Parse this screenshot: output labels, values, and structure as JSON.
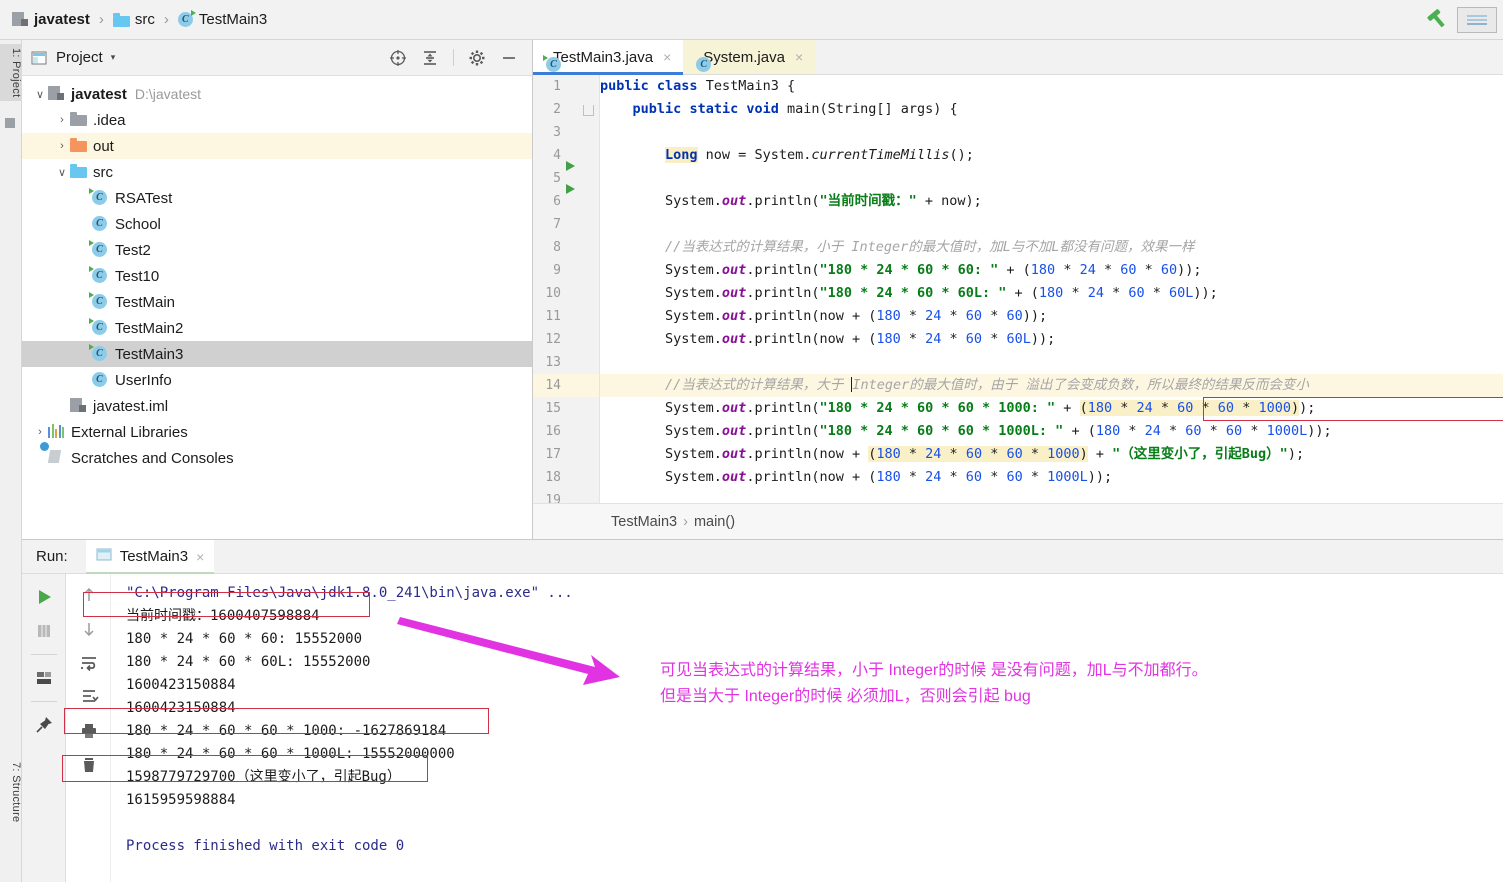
{
  "window": {
    "breadcrumb": [
      {
        "label": "javatest",
        "icon": "module-icon",
        "bold": true
      },
      {
        "label": "src",
        "icon": "folder-icon",
        "bold": false
      },
      {
        "label": "TestMain3",
        "icon": "java-class-icon",
        "bold": false
      }
    ],
    "hammer_icon": "build-hammer-icon",
    "restore_icon": "restore-window-icon"
  },
  "left_strip": {
    "project_tab": "1: Project",
    "structure_tab": "7: Structure"
  },
  "project_panel": {
    "title": "Project",
    "caret": "▾",
    "tools": [
      {
        "name": "locate-icon",
        "label": "Select Opened File"
      },
      {
        "name": "collapse-all-icon",
        "label": "Collapse All"
      },
      {
        "name": "gear-icon",
        "label": "Settings"
      },
      {
        "name": "minimize-icon",
        "label": "Hide"
      }
    ],
    "tree": [
      {
        "label": "javatest",
        "path": "D:\\javatest",
        "icon": "module-icon",
        "arrow": "∨",
        "indent": 0,
        "bold": true,
        "state": "normal"
      },
      {
        "label": ".idea",
        "path": "",
        "icon": "folder-gray-icon",
        "arrow": "›",
        "indent": 1,
        "bold": false,
        "state": "normal"
      },
      {
        "label": "out",
        "path": "",
        "icon": "folder-orange-icon",
        "arrow": "›",
        "indent": 1,
        "bold": false,
        "state": "highlight"
      },
      {
        "label": "src",
        "path": "",
        "icon": "folder-blue-icon",
        "arrow": "∨",
        "indent": 1,
        "bold": false,
        "state": "normal"
      },
      {
        "label": "RSATest",
        "path": "",
        "icon": "java-class-runnable-icon",
        "arrow": "",
        "indent": 2,
        "bold": false,
        "state": "normal"
      },
      {
        "label": "School",
        "path": "",
        "icon": "java-class-icon",
        "arrow": "",
        "indent": 2,
        "bold": false,
        "state": "normal"
      },
      {
        "label": "Test2",
        "path": "",
        "icon": "java-class-runnable-icon",
        "arrow": "",
        "indent": 2,
        "bold": false,
        "state": "normal"
      },
      {
        "label": "Test10",
        "path": "",
        "icon": "java-class-runnable-icon",
        "arrow": "",
        "indent": 2,
        "bold": false,
        "state": "normal"
      },
      {
        "label": "TestMain",
        "path": "",
        "icon": "java-class-runnable-icon",
        "arrow": "",
        "indent": 2,
        "bold": false,
        "state": "normal"
      },
      {
        "label": "TestMain2",
        "path": "",
        "icon": "java-class-runnable-icon",
        "arrow": "",
        "indent": 2,
        "bold": false,
        "state": "normal"
      },
      {
        "label": "TestMain3",
        "path": "",
        "icon": "java-class-runnable-icon",
        "arrow": "",
        "indent": 2,
        "bold": false,
        "state": "selected"
      },
      {
        "label": "UserInfo",
        "path": "",
        "icon": "java-class-icon",
        "arrow": "",
        "indent": 2,
        "bold": false,
        "state": "normal"
      },
      {
        "label": "javatest.iml",
        "path": "",
        "icon": "module-file-icon",
        "arrow": "",
        "indent": 1,
        "bold": false,
        "state": "normal"
      },
      {
        "label": "External Libraries",
        "path": "",
        "icon": "libraries-icon",
        "arrow": "›",
        "indent": 0,
        "bold": false,
        "state": "normal"
      },
      {
        "label": "Scratches and Consoles",
        "path": "",
        "icon": "scratches-icon",
        "arrow": "",
        "indent": 0,
        "bold": false,
        "state": "normal"
      }
    ]
  },
  "editor": {
    "tabs": [
      {
        "label": "TestMain3.java",
        "icon": "java-class-runnable-icon",
        "active": true,
        "close": "×"
      },
      {
        "label": "System.java",
        "icon": "java-class-readonly-icon",
        "active": false,
        "close": "×"
      }
    ],
    "breadcrumb": {
      "class": "TestMain3",
      "sep": "›",
      "method": "main()"
    },
    "line_numbers": [
      "1",
      "2",
      "3",
      "4",
      "5",
      "6",
      "7",
      "8",
      "9",
      "10",
      "11",
      "12",
      "13",
      "14",
      "15",
      "16",
      "17",
      "18",
      "19"
    ],
    "current_line": 14,
    "lines": [
      "public class TestMain3 {",
      "    public static void main(String[] args) {",
      "",
      "        Long now = System.currentTimeMillis();",
      "",
      "        System.out.println(\"当前时间戳：\" + now);",
      "",
      "        //当表达式的计算结果，小于 Integer的最大值时，加L与不加L都没有问题，效果一样",
      "        System.out.println(\"180 * 24 * 60 * 60: \" + (180 * 24 * 60 * 60));",
      "        System.out.println(\"180 * 24 * 60 * 60L: \" + (180 * 24 * 60 * 60L));",
      "        System.out.println(now + (180 * 24 * 60 * 60));",
      "        System.out.println(now + (180 * 24 * 60 * 60L));",
      "",
      "        //当表达式的计算结果，大于 Integer的最大值时，由于 溢出了会变成负数，所以最终的结果反而会变小",
      "        System.out.println(\"180 * 24 * 60 * 60 * 1000: \" + (180 * 24 * 60 * 60 * 1000));",
      "        System.out.println(\"180 * 24 * 60 * 60 * 1000L: \" + (180 * 24 * 60 * 60 * 1000L));",
      "        System.out.println(now + (180 * 24 * 60 * 60 * 1000) + \"（这里变小了，引起Bug）\");",
      "        System.out.println(now + (180 * 24 * 60 * 60 * 1000L));",
      ""
    ]
  },
  "run_panel": {
    "run_label": "Run:",
    "tab_label": "TestMain3",
    "tab_close": "×",
    "tools_left": [
      {
        "name": "run-icon"
      },
      {
        "name": "stop-icon"
      },
      {
        "name": "restore-layout-icon"
      },
      {
        "name": "pin-icon"
      }
    ],
    "tools_right": [
      {
        "name": "up-arrow-icon"
      },
      {
        "name": "down-arrow-icon"
      },
      {
        "name": "soft-wrap-icon"
      },
      {
        "name": "scroll-to-end-icon"
      },
      {
        "name": "print-icon"
      },
      {
        "name": "trash-icon"
      }
    ],
    "output": [
      {
        "text": "\"C:\\Program Files\\Java\\jdk1.8.0_241\\bin\\java.exe\" ...",
        "style": "blue",
        "boxed": false
      },
      {
        "text": "当前时间戳：1600407598884",
        "style": "normal",
        "boxed": true
      },
      {
        "text": "180 * 24 * 60 * 60: 15552000",
        "style": "normal",
        "boxed": false
      },
      {
        "text": "180 * 24 * 60 * 60L: 15552000",
        "style": "normal",
        "boxed": false
      },
      {
        "text": "1600423150884",
        "style": "normal",
        "boxed": false
      },
      {
        "text": "1600423150884",
        "style": "normal",
        "boxed": false
      },
      {
        "text": "180 * 24 * 60 * 60 * 1000: -1627869184",
        "style": "normal",
        "boxed": true
      },
      {
        "text": "180 * 24 * 60 * 60 * 1000L: 15552000000",
        "style": "normal",
        "boxed": false
      },
      {
        "text": "1598779729700（这里变小了，引起Bug）",
        "style": "normal",
        "boxed": true
      },
      {
        "text": "1615959598884",
        "style": "normal",
        "boxed": false
      },
      {
        "text": "",
        "style": "normal",
        "boxed": false
      },
      {
        "text": "Process finished with exit code 0",
        "style": "blue",
        "boxed": false
      }
    ]
  },
  "annotations": {
    "arrow_icon": "magenta-arrow-icon",
    "line1": "可见当表达式的计算结果，小于 Integer的时候 是没有问题，加L与不加都行。",
    "line2": "但是当大于 Integer的时候 必须加L，否则会引起 bug"
  },
  "colors": {
    "annotation": "#e233e2",
    "redbox": "#d02f44",
    "keyword": "#0033b3",
    "string": "#067d17",
    "number": "#1750eb",
    "comment": "#a5a5a5",
    "field": "#871094",
    "tab_active_underline": "#3b7dd8"
  }
}
